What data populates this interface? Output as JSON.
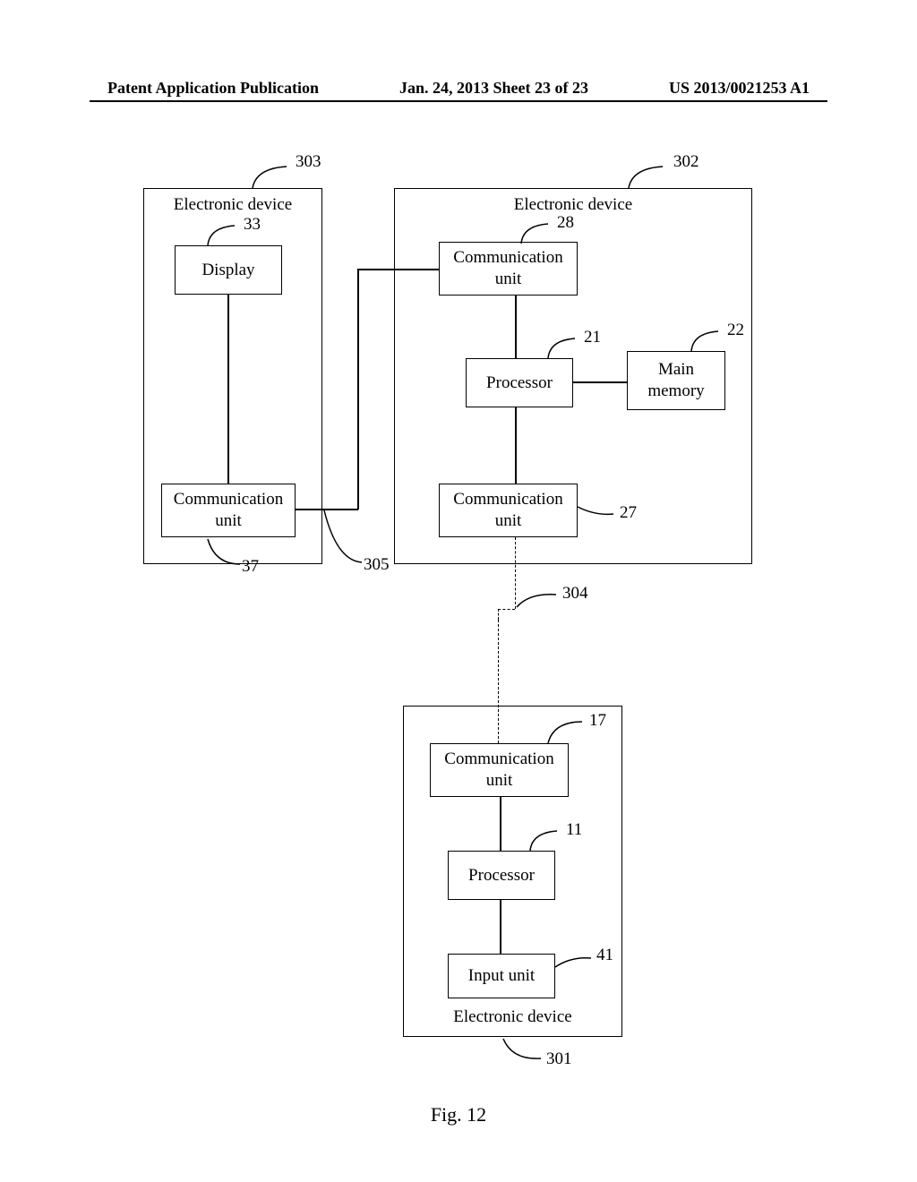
{
  "header": {
    "left": "Patent Application Publication",
    "center": "Jan. 24, 2013  Sheet 23 of 23",
    "right": "US 2013/0021253 A1"
  },
  "device303": {
    "title": "Electronic device",
    "display": "Display",
    "comm": "Communication unit",
    "ref_device": "303",
    "ref_display": "33",
    "ref_comm": "37"
  },
  "device302": {
    "title": "Electronic device",
    "comm1": "Communication unit",
    "processor": "Processor",
    "mainmem": "Main memory",
    "comm2": "Communication unit",
    "ref_device": "302",
    "ref_comm1": "28",
    "ref_processor": "21",
    "ref_mainmem": "22",
    "ref_comm2": "27"
  },
  "device301": {
    "title": "Electronic device",
    "comm": "Communication unit",
    "processor": "Processor",
    "input": "Input unit",
    "ref_device": "301",
    "ref_comm": "17",
    "ref_processor": "11",
    "ref_input": "41"
  },
  "links": {
    "ref_link_305": "305",
    "ref_link_304": "304"
  },
  "figure_caption": "Fig. 12"
}
